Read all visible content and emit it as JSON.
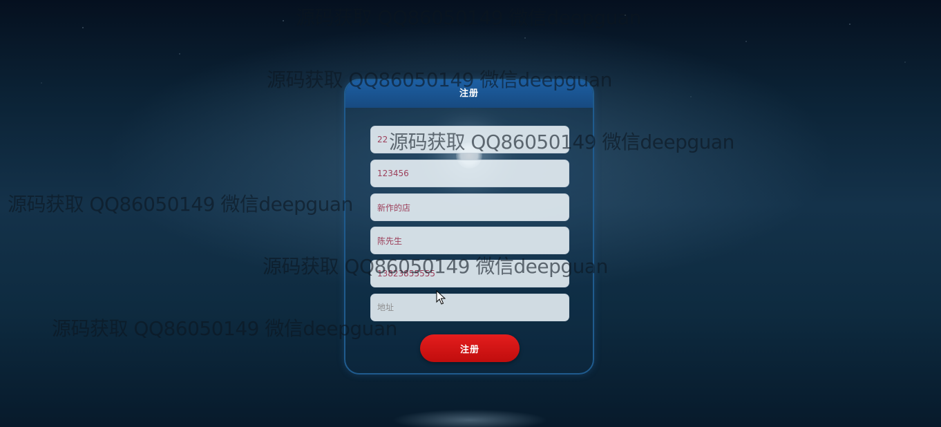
{
  "form": {
    "title": "注册",
    "fields": [
      {
        "name": "username",
        "value": "22",
        "placeholder": ""
      },
      {
        "name": "password",
        "value": "123456",
        "placeholder": ""
      },
      {
        "name": "shop-name",
        "value": "新作的店",
        "placeholder": ""
      },
      {
        "name": "contact-name",
        "value": "陈先生",
        "placeholder": ""
      },
      {
        "name": "phone",
        "value": "13823855555",
        "placeholder": ""
      },
      {
        "name": "address",
        "value": "",
        "placeholder": "地址"
      }
    ],
    "submit_label": "注册"
  },
  "watermark": {
    "text": "源码获取 QQ86050149 微信deepguan"
  },
  "colors": {
    "header": "#1d5fa3",
    "submit": "#e41d1d",
    "input_text": "#9c3f5a",
    "panel_border": "#1f5b8e"
  }
}
